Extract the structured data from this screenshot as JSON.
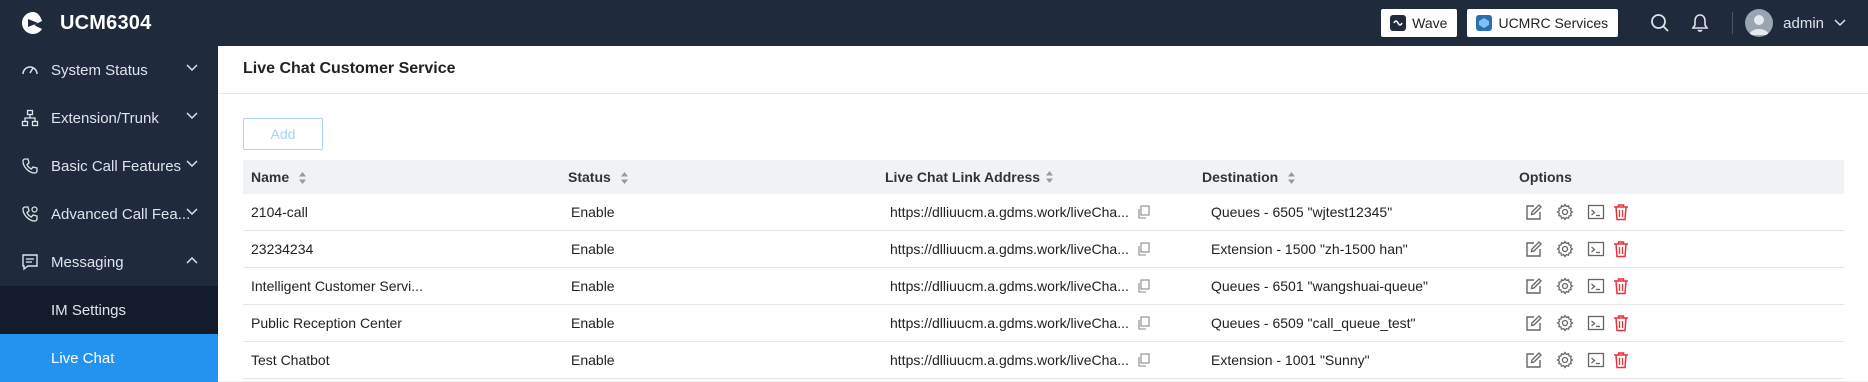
{
  "app": {
    "brand": "UCM6304"
  },
  "topbar": {
    "wave_label": "Wave",
    "ucmrc_label": "UCMRC Services",
    "user_name": "admin"
  },
  "sidebar": {
    "items": [
      {
        "label": "System Status",
        "icon": "gauge-icon"
      },
      {
        "label": "Extension/Trunk",
        "icon": "network-icon"
      },
      {
        "label": "Basic Call Features",
        "icon": "phone-icon"
      },
      {
        "label": "Advanced Call Fea...",
        "icon": "phone-settings-icon"
      },
      {
        "label": "Messaging",
        "icon": "message-icon"
      }
    ],
    "sub_items": [
      {
        "label": "IM Settings"
      },
      {
        "label": "Live Chat"
      }
    ]
  },
  "main": {
    "title": "Live Chat Customer Service",
    "add_label": "Add"
  },
  "table": {
    "headers": [
      "Name",
      "Status",
      "Live Chat Link Address",
      "Destination",
      "Options"
    ],
    "rows": [
      {
        "name": "2104-call",
        "status": "Enable",
        "link": "https://dlliuucm.a.gdms.work/liveCha...",
        "destination": "Queues - 6505 \"wjtest12345\""
      },
      {
        "name": "23234234",
        "status": "Enable",
        "link": "https://dlliuucm.a.gdms.work/liveCha...",
        "destination": "Extension - 1500 \"zh-1500 han\""
      },
      {
        "name": "Intelligent Customer Servi...",
        "status": "Enable",
        "link": "https://dlliuucm.a.gdms.work/liveCha...",
        "destination": "Queues - 6501 \"wangshuai-queue\""
      },
      {
        "name": "Public Reception Center",
        "status": "Enable",
        "link": "https://dlliuucm.a.gdms.work/liveCha...",
        "destination": "Queues - 6509 \"call_queue_test\""
      },
      {
        "name": "Test Chatbot",
        "status": "Enable",
        "link": "https://dlliuucm.a.gdms.work/liveCha...",
        "destination": "Extension - 1001 \"Sunny\""
      }
    ]
  },
  "colors": {
    "topbar_bg": "#1f2a3c",
    "active_nav": "#2493f0",
    "delete_red": "#e8313a",
    "add_button_border": "#a8d4fb"
  }
}
